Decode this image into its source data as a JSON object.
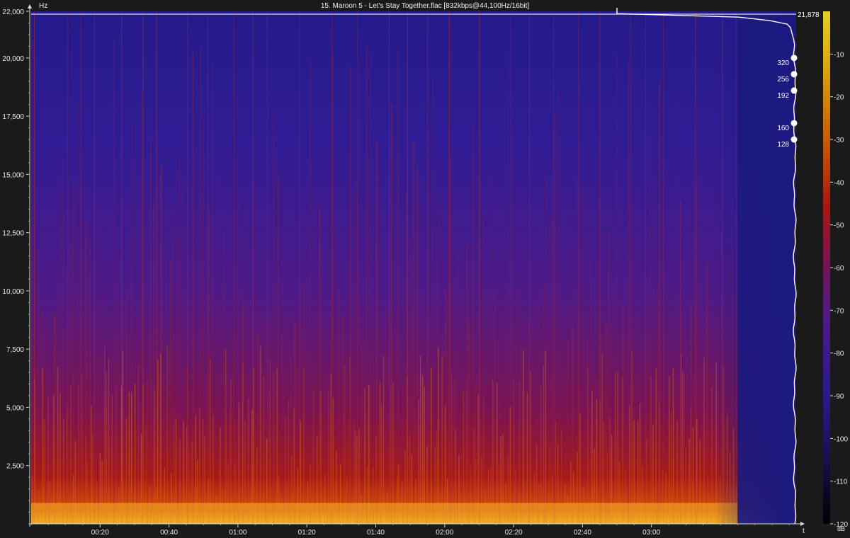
{
  "window": {
    "title": "15. Maroon 5 - Let's Stay Together.flac [832kbps@44,100Hz/16bit]"
  },
  "chart_data": {
    "type": "heatmap",
    "title": "15. Maroon 5 - Let's Stay Together.flac [832kbps@44,100Hz/16bit]",
    "xlabel": "t",
    "ylabel": "Hz",
    "colorbar_label": "dB",
    "x_range_seconds": [
      0,
      222
    ],
    "y_range_hz": [
      0,
      22000
    ],
    "x_ticks": [
      {
        "t": 20,
        "label": "00:20"
      },
      {
        "t": 40,
        "label": "00:40"
      },
      {
        "t": 60,
        "label": "01:00"
      },
      {
        "t": 80,
        "label": "01:20"
      },
      {
        "t": 100,
        "label": "01:40"
      },
      {
        "t": 120,
        "label": "02:00"
      },
      {
        "t": 140,
        "label": "02:20"
      },
      {
        "t": 160,
        "label": "02:40"
      },
      {
        "t": 180,
        "label": "03:00"
      }
    ],
    "y_ticks": [
      {
        "v": 2500,
        "label": "2,500"
      },
      {
        "v": 5000,
        "label": "5,000"
      },
      {
        "v": 7500,
        "label": "7,500"
      },
      {
        "v": 10000,
        "label": "10,000"
      },
      {
        "v": 12500,
        "label": "12,500"
      },
      {
        "v": 15000,
        "label": "15,000"
      },
      {
        "v": 17500,
        "label": "17,500"
      },
      {
        "v": 20000,
        "label": "20,000"
      },
      {
        "v": 22000,
        "label": "22,000"
      }
    ],
    "colorbar_range_db": [
      -120,
      0
    ],
    "colorbar_ticks": [
      {
        "v": -10,
        "label": "-10"
      },
      {
        "v": -20,
        "label": "-20"
      },
      {
        "v": -30,
        "label": "-30"
      },
      {
        "v": -40,
        "label": "-40"
      },
      {
        "v": -50,
        "label": "-50"
      },
      {
        "v": -60,
        "label": "-60"
      },
      {
        "v": -70,
        "label": "-70"
      },
      {
        "v": -80,
        "label": "-80"
      },
      {
        "v": -90,
        "label": "-90"
      },
      {
        "v": -100,
        "label": "-100"
      },
      {
        "v": -110,
        "label": "-110"
      },
      {
        "v": -120,
        "label": "-120"
      }
    ],
    "colormap": [
      "#000000",
      "#18105a",
      "#2c1a8e",
      "#5a1a82",
      "#8a1230",
      "#b01c0c",
      "#d8540a",
      "#f0a51c",
      "#f8e870"
    ],
    "cutoff_hz": 21878,
    "cutoff_label": "21,878",
    "bitrate_markers": [
      {
        "label": "320",
        "hz": 20000
      },
      {
        "label": "256",
        "hz": 19300
      },
      {
        "label": "192",
        "hz": 18600
      },
      {
        "label": "160",
        "hz": 17200
      },
      {
        "label": "128",
        "hz": 16500
      }
    ]
  }
}
